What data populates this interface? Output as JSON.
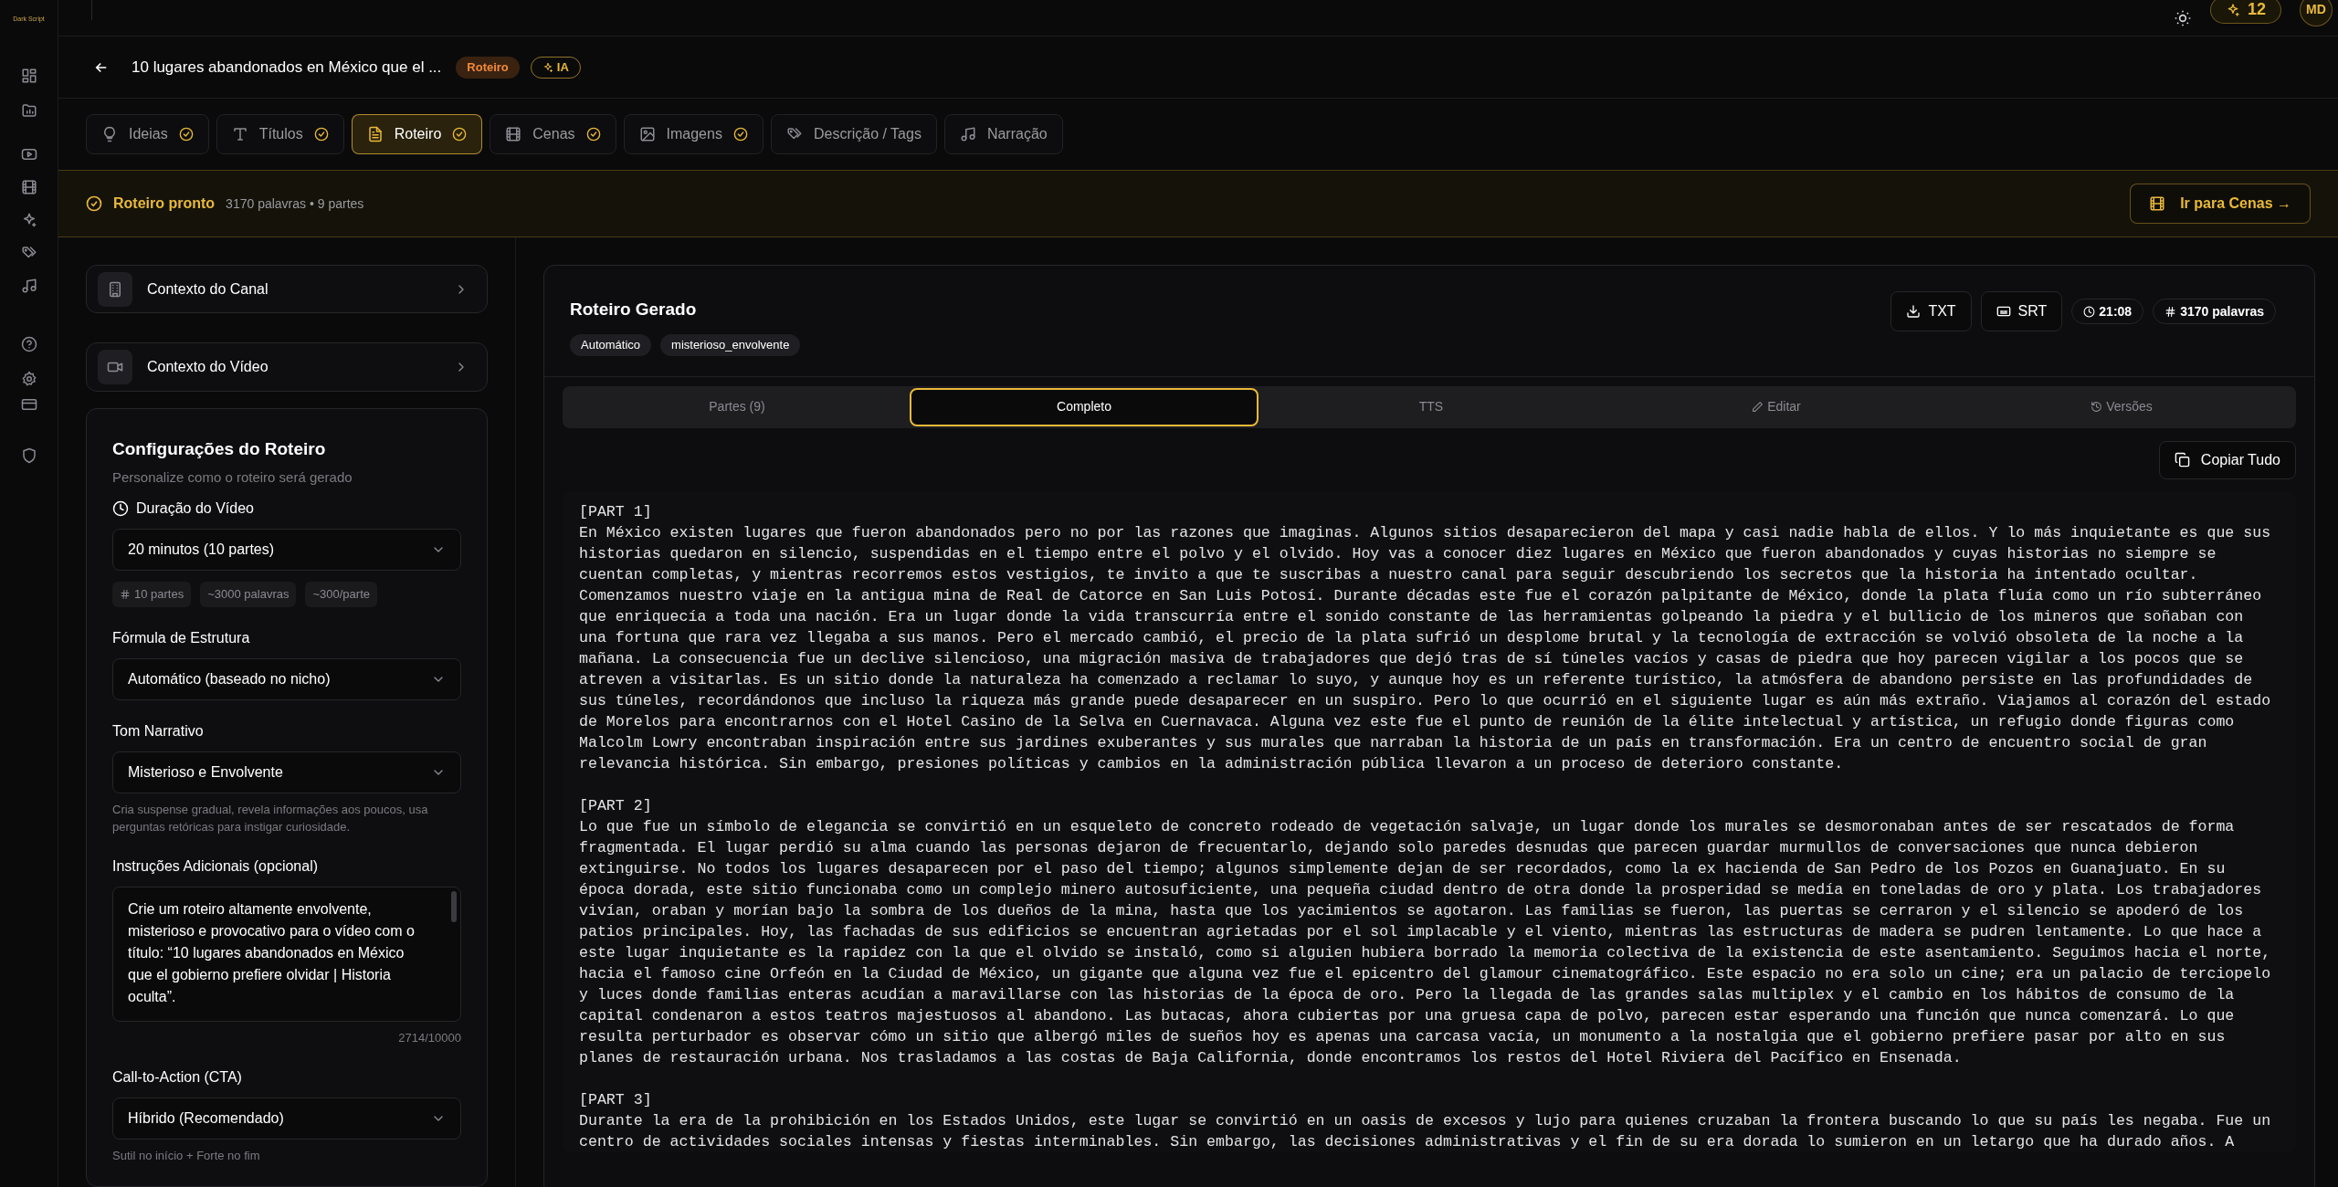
{
  "brand": {
    "logo_text": "Dark Script"
  },
  "topbar": {
    "credits": "12",
    "avatar": "MD"
  },
  "header": {
    "title": "10 lugares abandonados en México que el ...",
    "badges": [
      {
        "label": "Roteiro",
        "kind": "stage"
      },
      {
        "label": "IA",
        "kind": "ai"
      }
    ]
  },
  "steps": [
    {
      "label": "Ideias",
      "done": true,
      "selected": false
    },
    {
      "label": "Títulos",
      "done": true,
      "selected": false
    },
    {
      "label": "Roteiro",
      "done": true,
      "selected": true
    },
    {
      "label": "Cenas",
      "done": true,
      "selected": false
    },
    {
      "label": "Imagens",
      "done": true,
      "selected": false
    },
    {
      "label": "Descrição / Tags",
      "done": false,
      "selected": false
    },
    {
      "label": "Narração",
      "done": false,
      "selected": false
    }
  ],
  "banner": {
    "status": "Roteiro pronto",
    "meta": "3170 palavras • 9 partes",
    "action": "Ir para Cenas →"
  },
  "context_cards": [
    {
      "label": "Contexto do Canal"
    },
    {
      "label": "Contexto do Vídeo"
    }
  ],
  "settings": {
    "title": "Configurações do Roteiro",
    "subtitle": "Personalize como o roteiro será gerado",
    "fields": [
      {
        "kind": "select",
        "label": "Duração do Vídeo",
        "value": "20 minutos (10 partes)",
        "chips": [
          "10 partes",
          "~3000 palavras",
          "~300/parte"
        ]
      },
      {
        "kind": "select",
        "label": "Fórmula de Estrutura",
        "value": "Automático (baseado no nicho)"
      },
      {
        "kind": "select",
        "label": "Tom Narrativo",
        "value": "Misterioso e Envolvente",
        "hint": "Cria suspense gradual, revela informações aos poucos, usa perguntas retóricas para instigar curiosidade."
      },
      {
        "kind": "textarea",
        "label": "Instruções Adicionais (opcional)",
        "value": "Crie um roteiro altamente envolvente, misterioso e provocativo para o vídeo com o título: “10 lugares abandonados en México que el gobierno prefiere olvidar | Historia oculta”.",
        "counter": "2714/10000"
      },
      {
        "kind": "select",
        "label": "Call-to-Action (CTA)",
        "value": "Híbrido (Recomendado)",
        "hint": "Sutil no início + Forte no fim"
      }
    ]
  },
  "script": {
    "title": "Roteiro Gerado",
    "tags": [
      "Automático",
      "misterioso_envolvente"
    ],
    "actions": [
      {
        "label": "TXT",
        "kind": "download"
      },
      {
        "label": "SRT",
        "kind": "subtitles"
      },
      {
        "label": "21:08",
        "kind": "duration"
      },
      {
        "label": "3170 palavras",
        "kind": "words"
      }
    ],
    "view_tabs": [
      {
        "label": "Partes (9)",
        "selected": false
      },
      {
        "label": "Completo",
        "selected": true
      },
      {
        "label": "TTS",
        "selected": false
      },
      {
        "label": "Editar",
        "selected": false
      },
      {
        "label": "Versões",
        "selected": false
      }
    ],
    "copy": "Copiar Tudo",
    "parts": [
      {
        "label": "[PART 1]",
        "text": "En México existen lugares que fueron abandonados pero no por las razones que imaginas. Algunos sitios desaparecieron del mapa y casi nadie habla de ellos. Y lo más inquietante es que sus historias quedaron en silencio, suspendidas en el tiempo entre el polvo y el olvido. Hoy vas a conocer diez lugares en México que fueron abandonados y cuyas historias no siempre se cuentan completas, y mientras recorremos estos vestigios, te invito a que te suscribas a nuestro canal para seguir descubriendo los secretos que la historia ha intentado ocultar. Comenzamos nuestro viaje en la antigua mina de Real de Catorce en San Luis Potosí. Durante décadas este fue el corazón palpitante de México, donde la plata fluía como un río subterráneo que enriquecía a toda una nación. Era un lugar donde la vida transcurría entre el sonido constante de las herramientas golpeando la piedra y el bullicio de los mineros que soñaban con una fortuna que rara vez llegaba a sus manos. Pero el mercado cambió, el precio de la plata sufrió un desplome brutal y la tecnología de extracción se volvió obsoleta de la noche a la mañana. La consecuencia fue un declive silencioso, una migración masiva de trabajadores que dejó tras de sí túneles vacíos y casas de piedra que hoy parecen vigilar a los pocos que se atreven a visitarlas. Es un sitio donde la naturaleza ha comenzado a reclamar lo suyo, y aunque hoy es un referente turístico, la atmósfera de abandono persiste en las profundidades de sus túneles, recordándonos que incluso la riqueza más grande puede desaparecer en un suspiro. Pero lo que ocurrió en el siguiente lugar es aún más extraño. Viajamos al corazón del estado de Morelos para encontrarnos con el Hotel Casino de la Selva en Cuernavaca. Alguna vez este fue el punto de reunión de la élite intelectual y artística, un refugio donde figuras como Malcolm Lowry encontraban inspiración entre sus jardines exuberantes y sus murales que narraban la historia de un país en transformación. Era un centro de encuentro social de gran relevancia histórica. Sin embargo, presiones políticas y cambios en la administración pública llevaron a un proceso de deterioro constante."
      },
      {
        "label": "[PART 2]",
        "text": "Lo que fue un símbolo de elegancia se convirtió en un esqueleto de concreto rodeado de vegetación salvaje, un lugar donde los murales se desmoronaban antes de ser rescatados de forma fragmentada. El lugar perdió su alma cuando las personas dejaron de frecuentarlo, dejando solo paredes desnudas que parecen guardar murmullos de conversaciones que nunca debieron extinguirse. No todos los lugares desaparecen por el paso del tiempo; algunos simplemente dejan de ser recordados, como la ex hacienda de San Pedro de los Pozos en Guanajuato. En su época dorada, este sitio funcionaba como un complejo minero autosuficiente, una pequeña ciudad dentro de otra donde la prosperidad se medía en toneladas de oro y plata. Los trabajadores vivían, oraban y morían bajo la sombra de los dueños de la mina, hasta que los yacimientos se agotaron. Las familias se fueron, las puertas se cerraron y el silencio se apoderó de los patios principales. Hoy, las fachadas de sus edificios se encuentran agrietadas por el sol implacable y el viento, mientras las estructuras de madera se pudren lentamente. Lo que hace a este lugar inquietante es la rapidez con la que el olvido se instaló, como si alguien hubiera borrado la memoria colectiva de la existencia de este asentamiento. Seguimos hacia el norte, hacia el famoso cine Orfeón en la Ciudad de México, un gigante que alguna vez fue el epicentro del glamour cinematográfico. Este espacio no era solo un cine; era un palacio de terciopelo y luces donde familias enteras acudían a maravillarse con las historias de la época de oro. Pero la llegada de las grandes salas multiplex y el cambio en los hábitos de consumo de la capital condenaron a estos teatros majestuosos al abandono. Las butacas, ahora cubiertas por una gruesa capa de polvo, parecen estar esperando una función que nunca comenzará. Lo que resulta perturbador es observar cómo un sitio que albergó miles de sueños hoy es apenas una carcasa vacía, un monumento a la nostalgia que el gobierno prefiere pasar por alto en sus planes de restauración urbana. Nos trasladamos a las costas de Baja California, donde encontramos los restos del Hotel Riviera del Pacífico en Ensenada."
      },
      {
        "label": "[PART 3]",
        "text": "Durante la era de la prohibición en los Estados Unidos, este lugar se convirtió en un oasis de excesos y lujo para quienes cruzaban la frontera buscando lo que su país les negaba. Fue un centro de actividades sociales intensas y fiestas interminables. Sin embargo, las decisiones administrativas y el fin de su era dorada lo sumieron en un letargo que ha durado años. A"
      }
    ]
  }
}
